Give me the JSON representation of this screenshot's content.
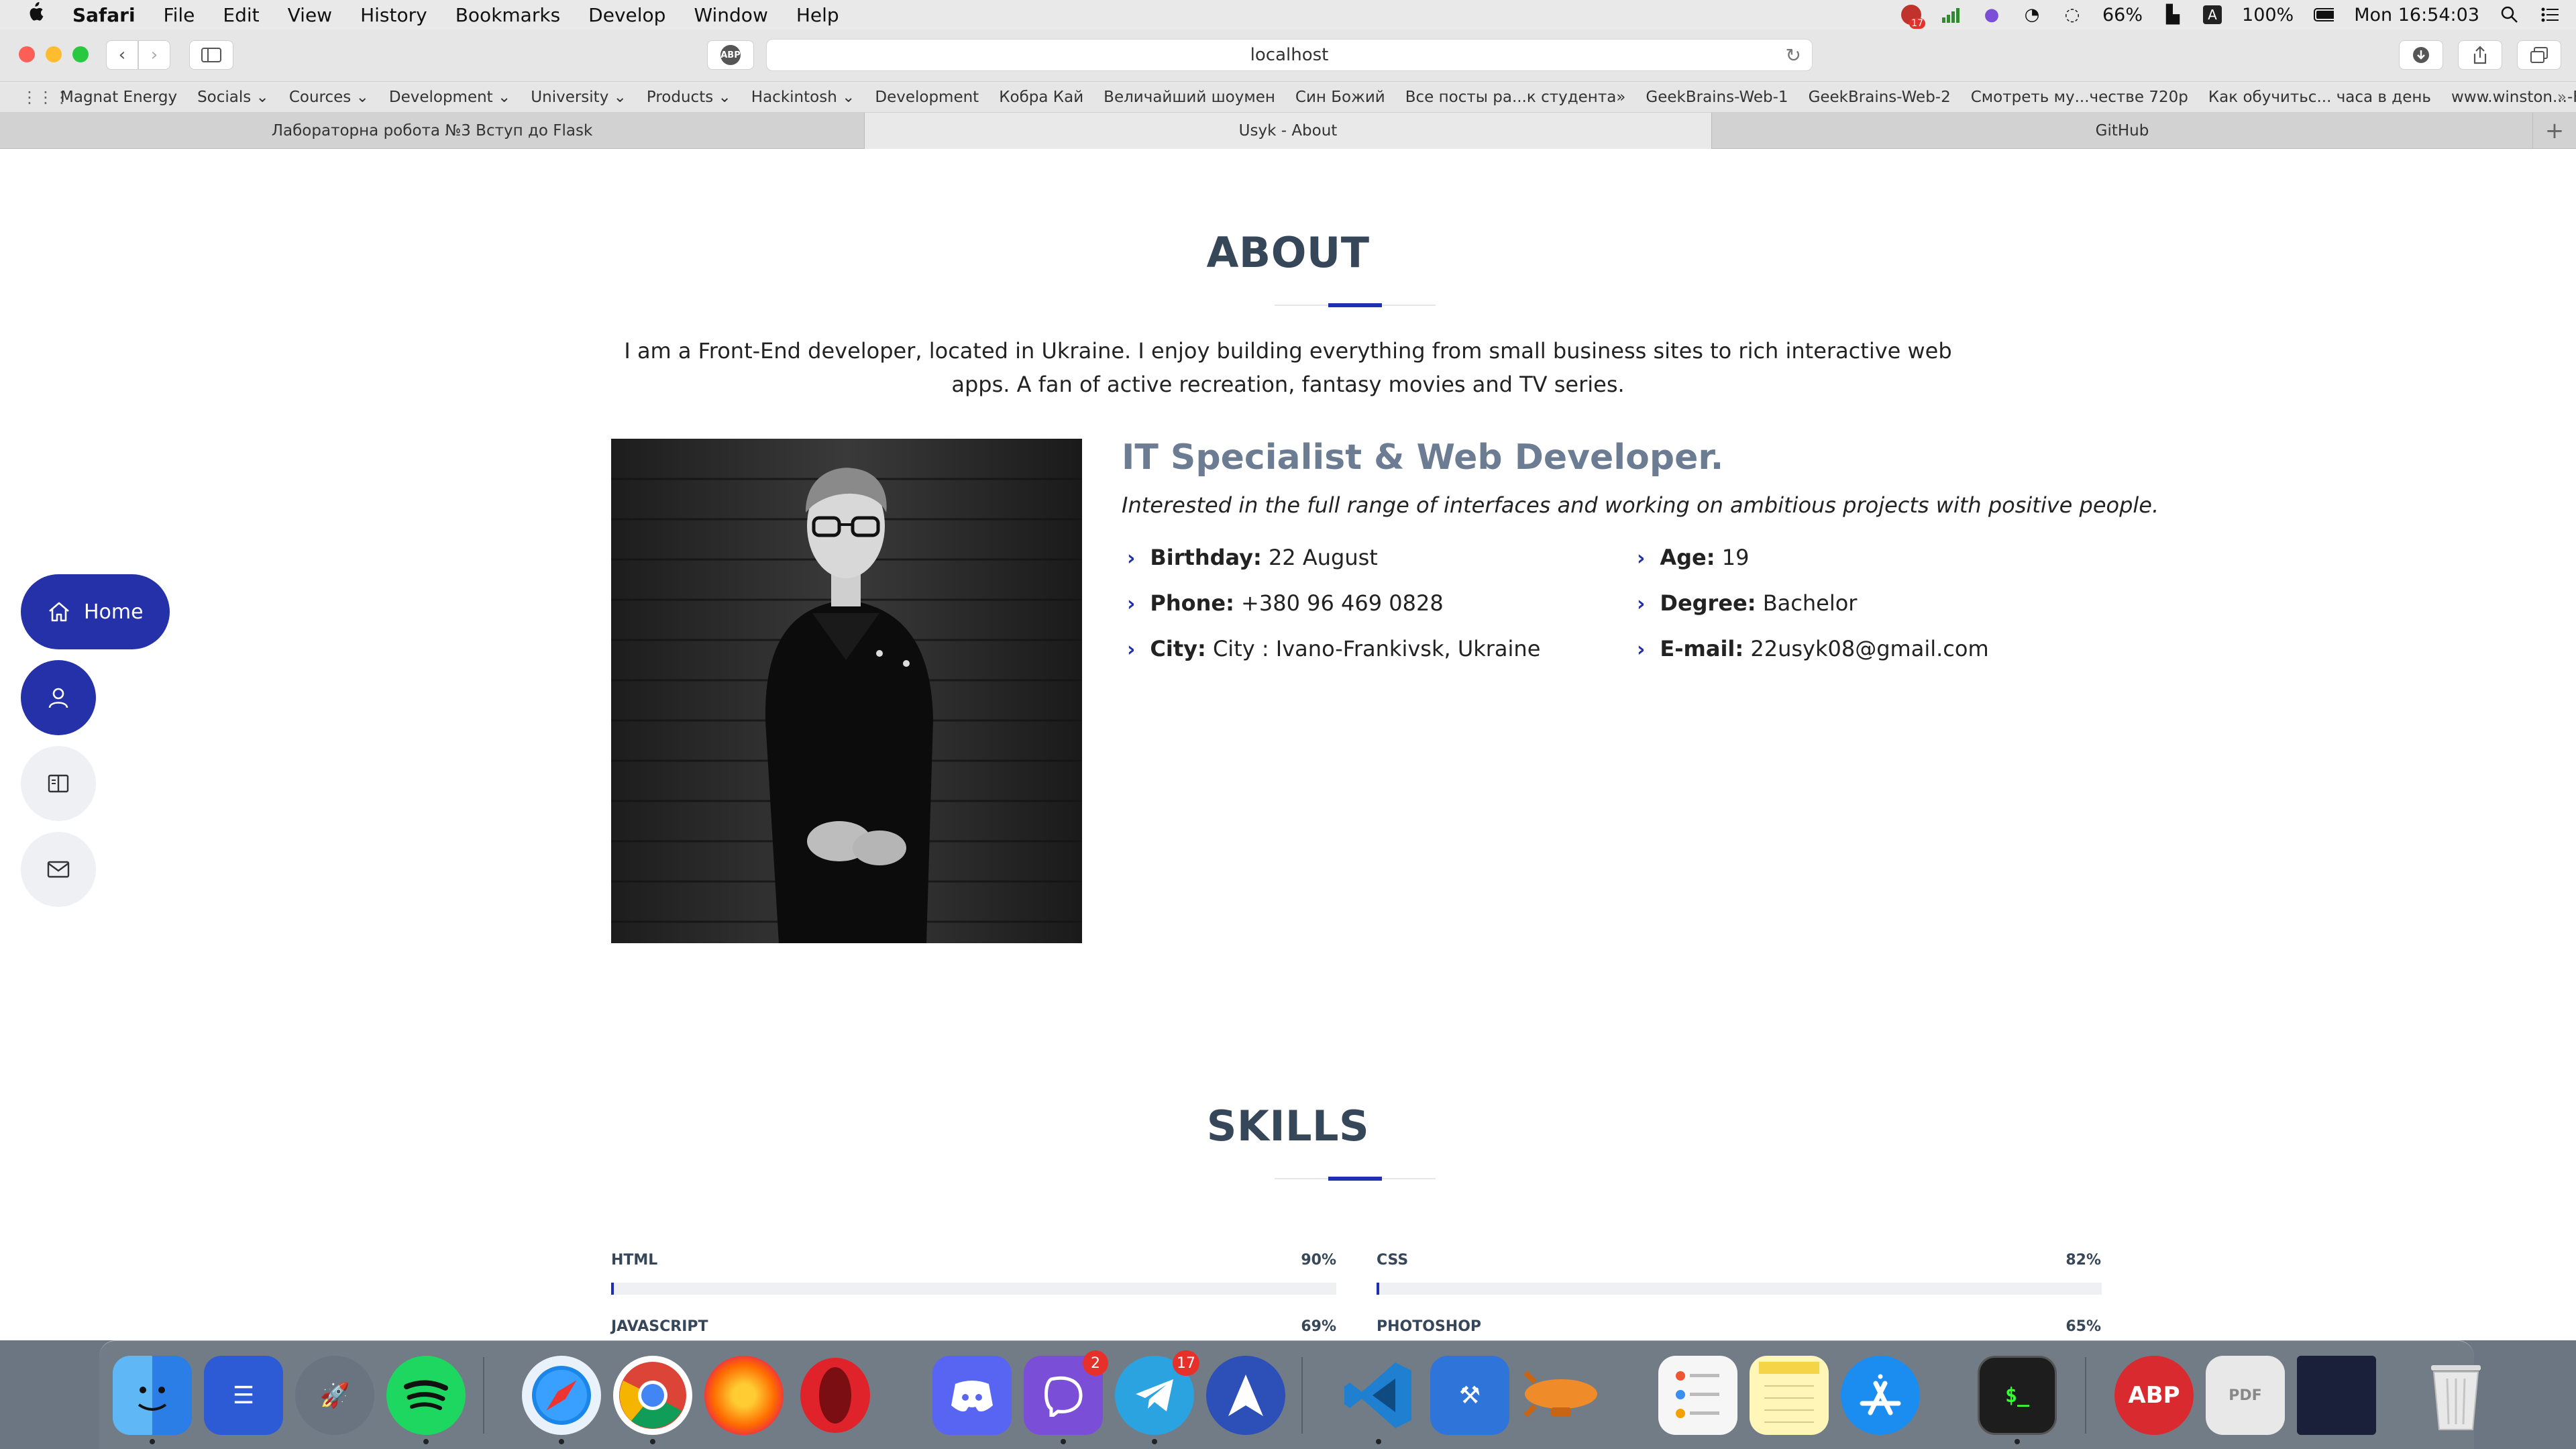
{
  "menubar": {
    "app": "Safari",
    "items": [
      "File",
      "Edit",
      "View",
      "History",
      "Bookmarks",
      "Develop",
      "Window",
      "Help"
    ],
    "status": {
      "badge_count": "17",
      "battery_small": "66%",
      "battery": "100%",
      "input_letter": "A",
      "clock": "Mon 16:54:03"
    }
  },
  "toolbar": {
    "address": "localhost",
    "adblock_label": "ABP"
  },
  "bookmarks": [
    "Magnat Energy",
    "Socials ⌄",
    "Cources ⌄",
    "Development ⌄",
    "University ⌄",
    "Products ⌄",
    "Hackintosh ⌄",
    "Development",
    "Кобра Кай",
    "Величайший шоумен",
    "Син Божий",
    "Все посты ра...к студента»",
    "GeekBrains-Web-1",
    "GeekBrains-Web-2",
    "Смотреть му...честве 720p",
    "Как обучитьс... часа в день",
    "www.winston...-Frames.svg"
  ],
  "tabs": [
    {
      "title": "Лабораторна робота №3 Вступ до Flask",
      "active": false
    },
    {
      "title": "Usyk - About",
      "active": true
    },
    {
      "title": "GitHub",
      "active": false
    }
  ],
  "nav": {
    "home_label": "Home"
  },
  "about": {
    "title": "ABOUT",
    "description": "I am a Front-End developer, located in Ukraine. I enjoy building everything from small business sites to rich interactive web apps. A fan of active recreation, fantasy movies and TV series.",
    "heading": "IT Specialist & Web Developer.",
    "tagline": "Interested in the full range of interfaces and working on ambitious projects with positive people.",
    "info_left": [
      {
        "label": "Birthday:",
        "value": "22 August"
      },
      {
        "label": "Phone:",
        "value": "+380 96 469 0828"
      },
      {
        "label": "City:",
        "value": "City : Ivano-Frankivsk, Ukraine"
      }
    ],
    "info_right": [
      {
        "label": "Age:",
        "value": "19"
      },
      {
        "label": "Degree:",
        "value": "Bachelor"
      },
      {
        "label": "E-mail:",
        "value": "22usyk08@gmail.com"
      }
    ]
  },
  "skills": {
    "title": "SKILLS",
    "items": [
      {
        "name": "HTML",
        "percent_label": "90%",
        "level": 0.004
      },
      {
        "name": "CSS",
        "percent_label": "82%",
        "level": 0.004
      },
      {
        "name": "JAVASCRIPT",
        "percent_label": "69%"
      },
      {
        "name": "PHOTOSHOP",
        "percent_label": "65%"
      }
    ]
  },
  "dock": {
    "viber_badge": "2",
    "telegram_badge": "17",
    "abp_label": "ABP"
  },
  "colors": {
    "accent": "#1f2fb4",
    "heading": "#37475a",
    "subheading": "#6b7c93"
  }
}
